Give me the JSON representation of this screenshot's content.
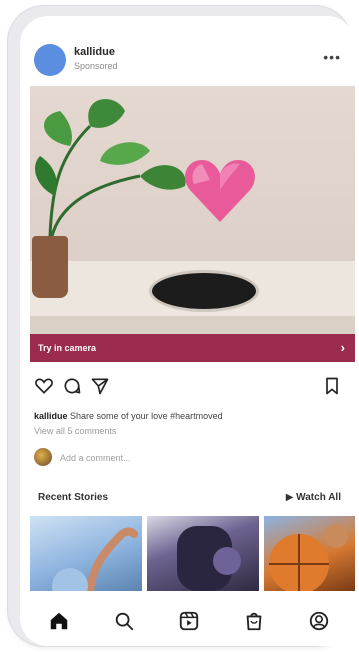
{
  "post": {
    "username": "kallidue",
    "sponsored_label": "Sponsored",
    "more_label": "•••"
  },
  "media": {
    "cta_label": "Try in camera",
    "cta_arrow": "›"
  },
  "caption": {
    "username": "kallidue",
    "text": "Share some of your love #heartmoved",
    "view_comments": "View all 5 comments",
    "comment_placeholder": "Add a comment..."
  },
  "stories": {
    "title": "Recent Stories",
    "watch_all": "▶ Watch All"
  },
  "colors": {
    "avatar": "#5b8de0",
    "cta_bg": "#9b2c4d",
    "heart": "#e85a9a"
  },
  "icons": {
    "actions": [
      "heart-icon",
      "comment-icon",
      "share-icon",
      "bookmark-icon"
    ],
    "tabbar": [
      "home-icon",
      "search-icon",
      "reels-icon",
      "shop-icon",
      "profile-icon"
    ]
  }
}
